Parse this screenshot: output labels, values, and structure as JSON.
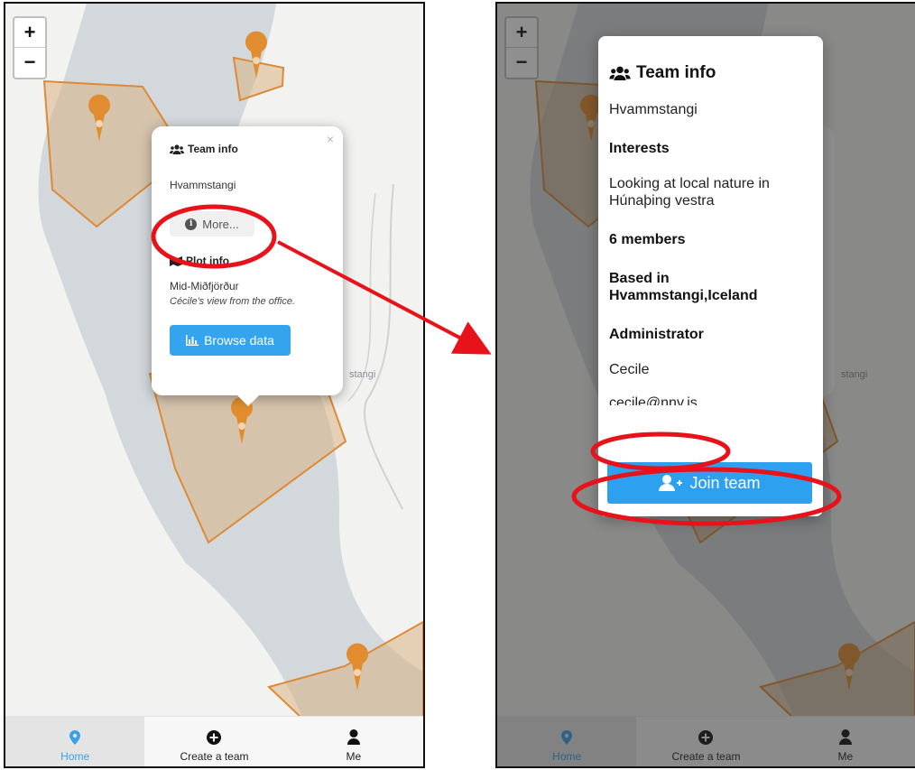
{
  "zoom": {
    "in_label": "+",
    "out_label": "−"
  },
  "map": {
    "town_label": "stangi"
  },
  "popup": {
    "close_label": "×",
    "team_heading": "Team info",
    "team_name": "Hvammstangi",
    "more_label": "More...",
    "plot_heading": "Plot info",
    "plot_name": "Mid-Miðfjörður",
    "plot_description": "Cécile's view from the office.",
    "browse_label": "Browse data"
  },
  "tabs": [
    {
      "label": "Home",
      "icon": "map-marker-icon",
      "active": true
    },
    {
      "label": "Create a team",
      "icon": "plus-circle-icon"
    },
    {
      "label": "Me",
      "icon": "user-icon"
    }
  ],
  "modal": {
    "heading": "Team info",
    "team_name": "Hvammstangi",
    "interests_heading": "Interests",
    "interests_text": "Looking at local nature in Húnaþing vestra",
    "members": "6 members",
    "based_heading": "Based in Hvammstangi,Iceland",
    "admin_heading": "Administrator",
    "admin_name": "Cecile",
    "admin_email": "cecile@nnv.is",
    "join_label": "Join team"
  },
  "colors": {
    "accent": "#34a4ee",
    "marker": "#e18d2f",
    "polygon_fill": "#d8ad7b",
    "annotation": "#e8121b"
  }
}
